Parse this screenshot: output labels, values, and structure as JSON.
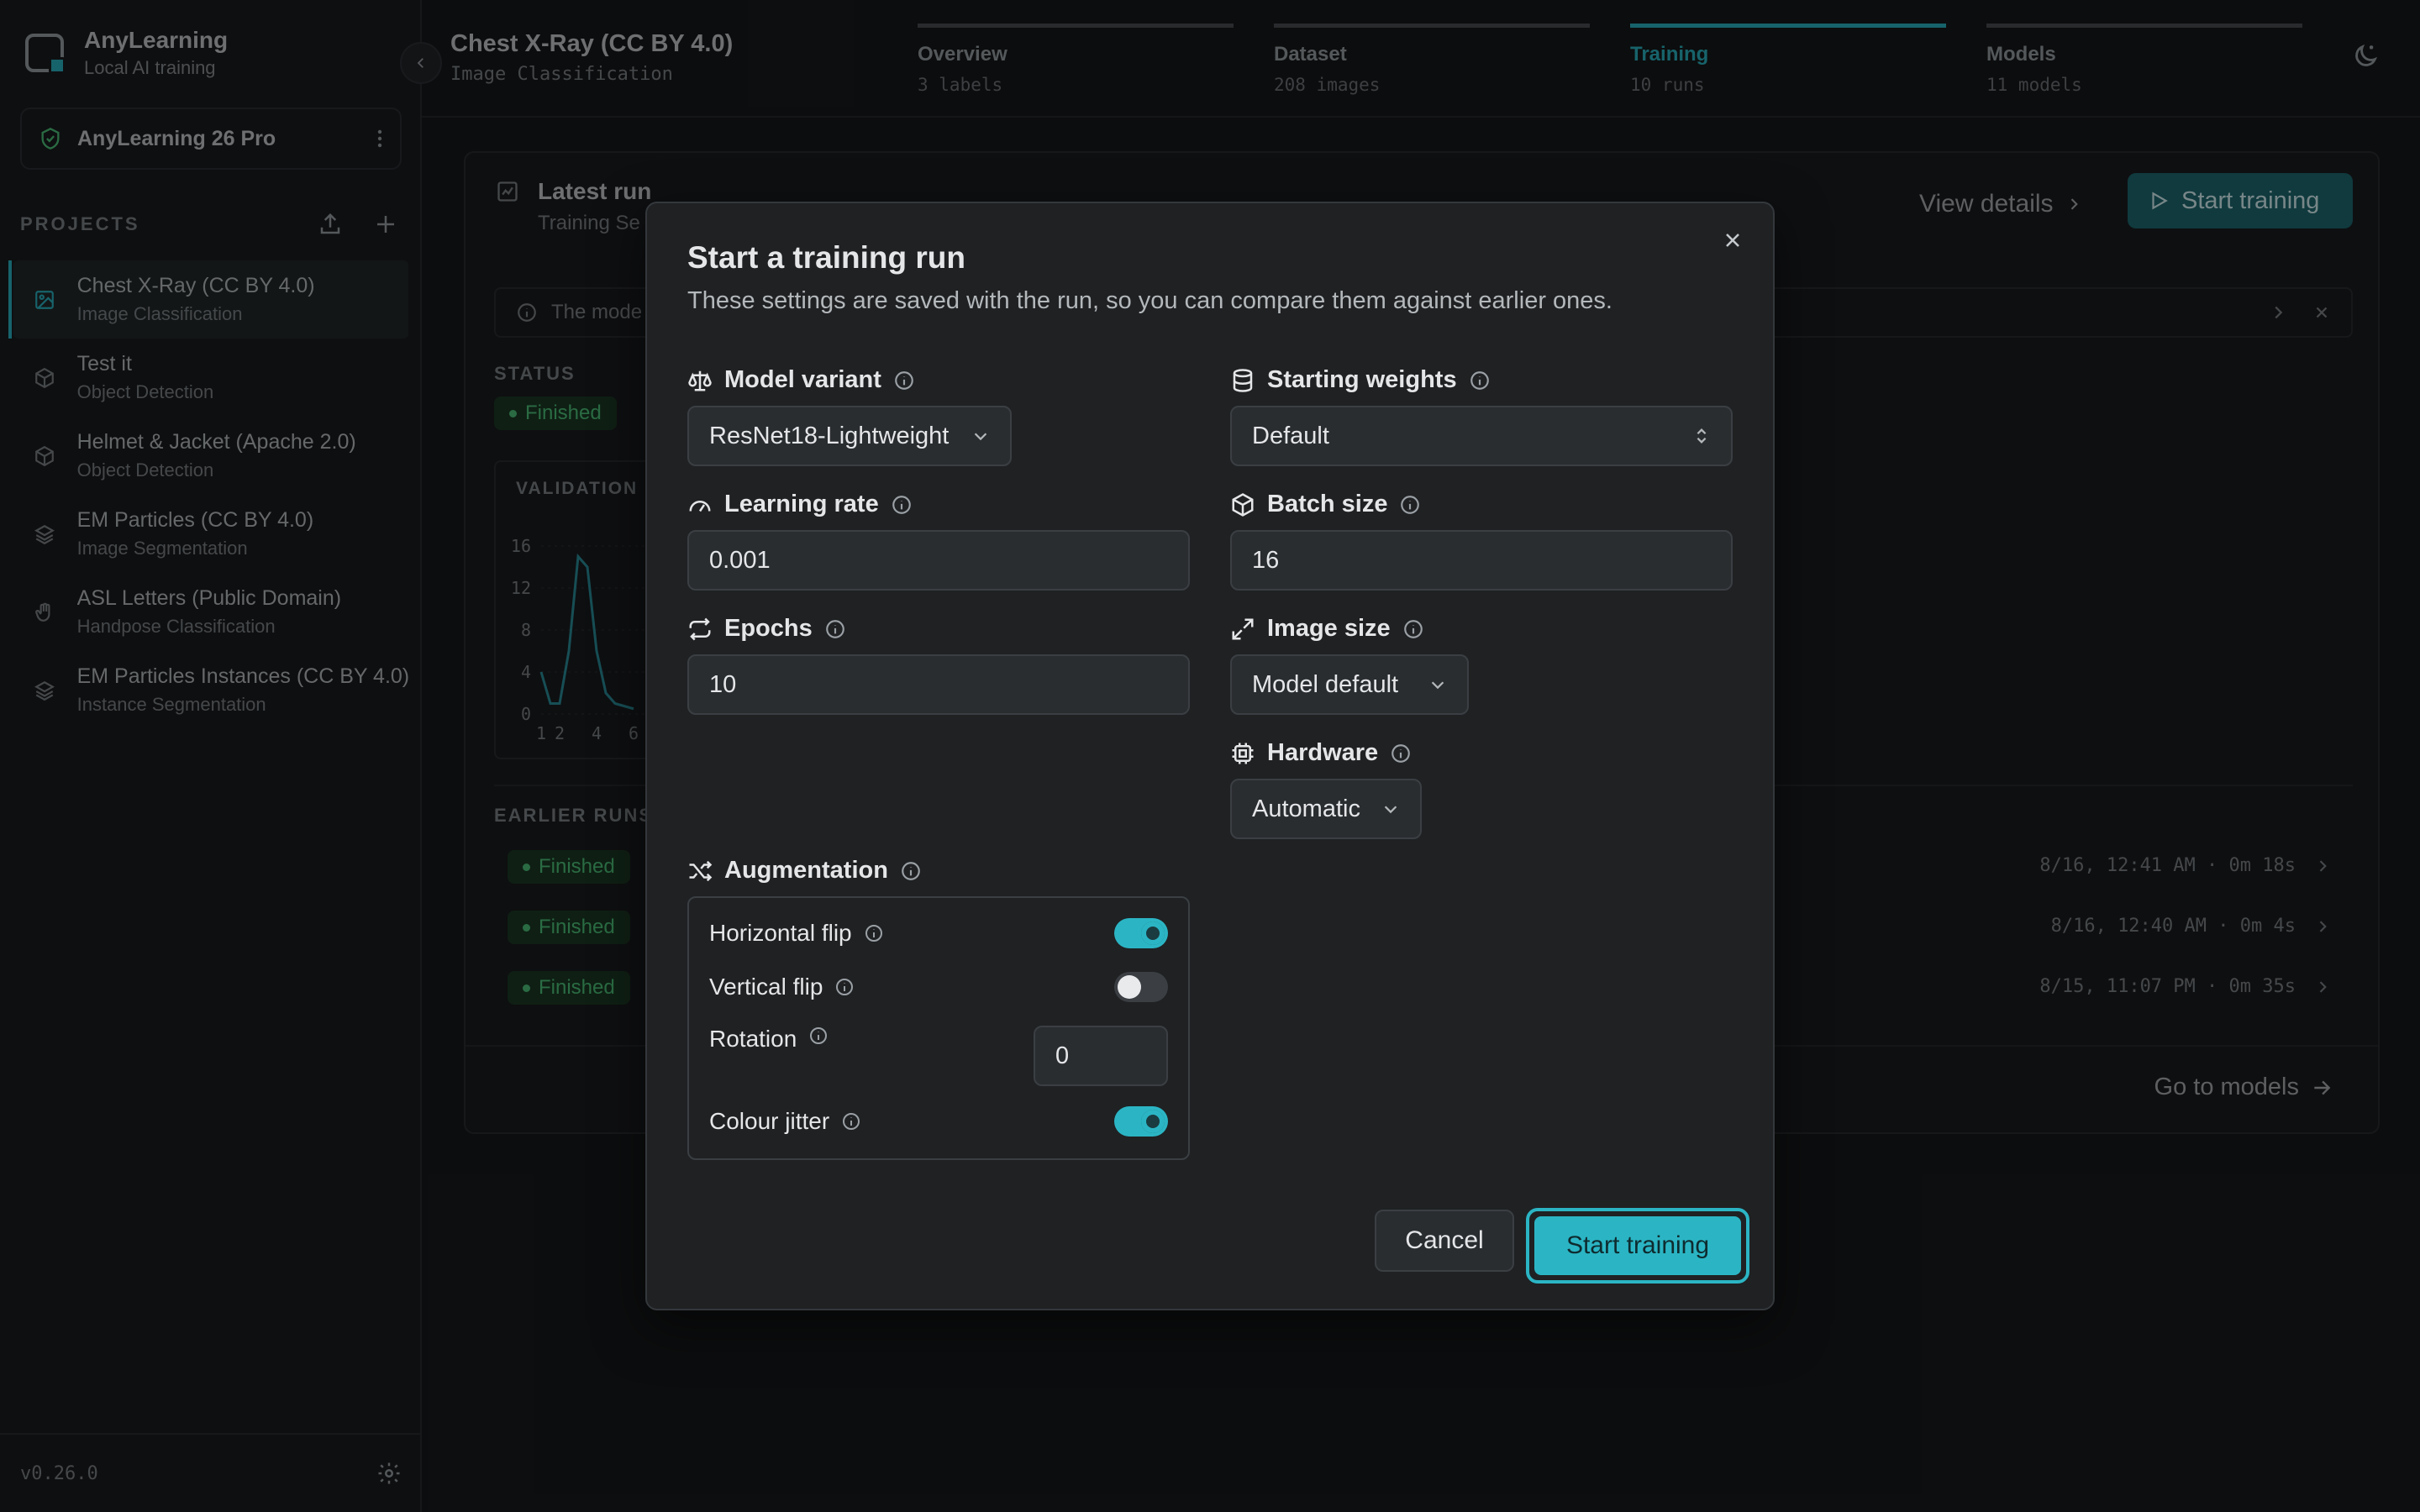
{
  "sidebar": {
    "brand_name": "AnyLearning",
    "brand_sub": "Local AI training",
    "license": "AnyLearning 26 Pro",
    "projects_title": "PROJECTS",
    "projects": [
      {
        "name": "Chest X-Ray (CC BY 4.0)",
        "type": "Image Classification",
        "icon": "image-icon"
      },
      {
        "name": "Test it",
        "type": "Object Detection",
        "icon": "cube-icon"
      },
      {
        "name": "Helmet & Jacket (Apache 2.0)",
        "type": "Object Detection",
        "icon": "cube-icon"
      },
      {
        "name": "EM Particles (CC BY 4.0)",
        "type": "Image Segmentation",
        "icon": "layers-icon"
      },
      {
        "name": "ASL Letters (Public Domain)",
        "type": "Handpose Classification",
        "icon": "hand-icon"
      },
      {
        "name": "EM Particles Instances (CC BY 4.0)",
        "type": "Instance Segmentation",
        "icon": "layers-icon"
      }
    ],
    "version": "v0.26.0"
  },
  "topbar": {
    "project_title": "Chest X-Ray (CC BY 4.0)",
    "project_sub": "Image Classification",
    "steps": [
      {
        "label": "Overview",
        "sub": "3 labels"
      },
      {
        "label": "Dataset",
        "sub": "208 images"
      },
      {
        "label": "Training",
        "sub": "10 runs"
      },
      {
        "label": "Models",
        "sub": "11 models"
      }
    ],
    "active_step": "Training"
  },
  "main": {
    "latest_title": "Latest run",
    "latest_sub": "Training Se",
    "view_details": "View details",
    "start_training": "Start training",
    "notice": "The mode",
    "status_label": "STATUS",
    "status_value": "Finished",
    "chart_title": "VALIDATION",
    "earlier_label": "EARLIER RUNS",
    "earlier_runs": [
      {
        "status": "Finished",
        "meta": "8/16, 12:41 AM · 0m 18s"
      },
      {
        "status": "Finished",
        "meta": "8/16, 12:40 AM · 0m 4s"
      },
      {
        "status": "Finished",
        "meta": "8/15, 11:07 PM · 0m 35s"
      }
    ],
    "go_models": "Go to models"
  },
  "chart_data": {
    "type": "line",
    "title": "VALIDATION",
    "y_ticks": [
      "16",
      "12",
      "8",
      "4",
      "0"
    ],
    "x_ticks": [
      "1",
      "2",
      "4",
      "6"
    ],
    "ylim": [
      0,
      16
    ],
    "x": [
      1,
      1.5,
      2,
      2.5,
      3,
      3.5,
      4,
      4.5,
      5,
      6
    ],
    "series": [
      {
        "values": [
          4,
          1,
          1,
          6,
          15,
          14,
          6,
          2,
          1,
          0.5
        ]
      }
    ],
    "grid": true
  },
  "modal": {
    "title": "Start a training run",
    "description": "These settings are saved with the run, so you can compare them against earlier ones.",
    "model_variant_label": "Model variant",
    "model_variant_value": "ResNet18-Lightweight",
    "starting_weights_label": "Starting weights",
    "starting_weights_value": "Default",
    "learning_rate_label": "Learning rate",
    "learning_rate_value": "0.001",
    "batch_size_label": "Batch size",
    "batch_size_value": "16",
    "epochs_label": "Epochs",
    "epochs_value": "10",
    "image_size_label": "Image size",
    "image_size_value": "Model default",
    "hardware_label": "Hardware",
    "hardware_value": "Automatic",
    "augmentation_label": "Augmentation",
    "augmentation": {
      "horizontal_flip_label": "Horizontal flip",
      "horizontal_flip_on": true,
      "vertical_flip_label": "Vertical flip",
      "vertical_flip_on": false,
      "rotation_label": "Rotation",
      "rotation_value": "0",
      "colour_jitter_label": "Colour jitter",
      "colour_jitter_on": true
    },
    "cancel_label": "Cancel",
    "start_label": "Start training"
  },
  "colors": {
    "accent": "#2bb5c4",
    "success": "#4ec47a",
    "background": "#17191b"
  }
}
